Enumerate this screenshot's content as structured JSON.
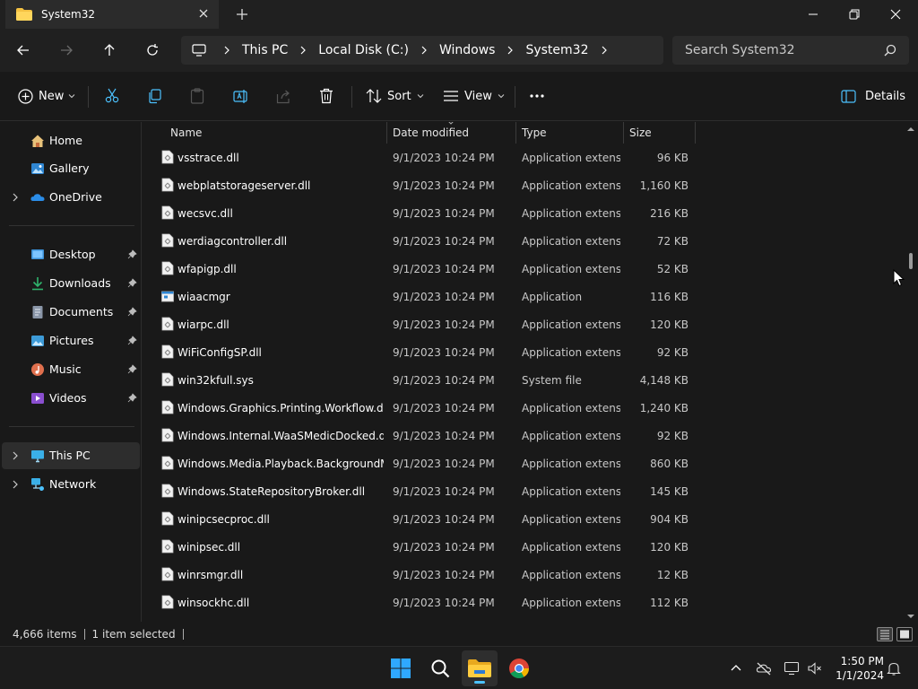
{
  "window": {
    "tab_title": "System32"
  },
  "address": {
    "crumbs": [
      "This PC",
      "Local Disk (C:)",
      "Windows",
      "System32"
    ],
    "search_placeholder": "Search System32"
  },
  "commands": {
    "new_label": "New",
    "sort_label": "Sort",
    "view_label": "View",
    "details_label": "Details"
  },
  "nav": {
    "top": [
      {
        "label": "Home",
        "icon": "home-icon",
        "expandable": false
      },
      {
        "label": "Gallery",
        "icon": "gallery-icon",
        "expandable": false
      },
      {
        "label": "OneDrive",
        "icon": "onedrive-icon",
        "expandable": true
      }
    ],
    "quick": [
      {
        "label": "Desktop",
        "icon": "desktop-icon",
        "color": "#3a8fd6"
      },
      {
        "label": "Downloads",
        "icon": "downloads-icon",
        "color": "#2fb36c"
      },
      {
        "label": "Documents",
        "icon": "documents-icon",
        "color": "#8a96a8"
      },
      {
        "label": "Pictures",
        "icon": "pictures-icon",
        "color": "#3d9bd8"
      },
      {
        "label": "Music",
        "icon": "music-icon",
        "color": "#e0704e"
      },
      {
        "label": "Videos",
        "icon": "videos-icon",
        "color": "#8a4fd0"
      }
    ],
    "devices": [
      {
        "label": "This PC",
        "icon": "this-pc-icon",
        "selected": true
      },
      {
        "label": "Network",
        "icon": "network-icon",
        "selected": false
      }
    ]
  },
  "columns": {
    "name": "Name",
    "date": "Date modified",
    "type": "Type",
    "size": "Size"
  },
  "files": [
    {
      "name": "vsstrace.dll",
      "date": "9/1/2023 10:24 PM",
      "type": "Application extens...",
      "size": "96 KB",
      "icon": "dll-file-icon"
    },
    {
      "name": "webplatstorageserver.dll",
      "date": "9/1/2023 10:24 PM",
      "type": "Application extens...",
      "size": "1,160 KB",
      "icon": "dll-file-icon"
    },
    {
      "name": "wecsvc.dll",
      "date": "9/1/2023 10:24 PM",
      "type": "Application extens...",
      "size": "216 KB",
      "icon": "dll-file-icon"
    },
    {
      "name": "werdiagcontroller.dll",
      "date": "9/1/2023 10:24 PM",
      "type": "Application extens...",
      "size": "72 KB",
      "icon": "dll-file-icon"
    },
    {
      "name": "wfapigp.dll",
      "date": "9/1/2023 10:24 PM",
      "type": "Application extens...",
      "size": "52 KB",
      "icon": "dll-file-icon"
    },
    {
      "name": "wiaacmgr",
      "date": "9/1/2023 10:24 PM",
      "type": "Application",
      "size": "116 KB",
      "icon": "exe-file-icon"
    },
    {
      "name": "wiarpc.dll",
      "date": "9/1/2023 10:24 PM",
      "type": "Application extens...",
      "size": "120 KB",
      "icon": "dll-file-icon"
    },
    {
      "name": "WiFiConfigSP.dll",
      "date": "9/1/2023 10:24 PM",
      "type": "Application extens...",
      "size": "92 KB",
      "icon": "dll-file-icon"
    },
    {
      "name": "win32kfull.sys",
      "date": "9/1/2023 10:24 PM",
      "type": "System file",
      "size": "4,148 KB",
      "icon": "sys-file-icon"
    },
    {
      "name": "Windows.Graphics.Printing.Workflow.dll",
      "date": "9/1/2023 10:24 PM",
      "type": "Application extens...",
      "size": "1,240 KB",
      "icon": "dll-file-icon"
    },
    {
      "name": "Windows.Internal.WaaSMedicDocked.dll",
      "date": "9/1/2023 10:24 PM",
      "type": "Application extens...",
      "size": "92 KB",
      "icon": "dll-file-icon"
    },
    {
      "name": "Windows.Media.Playback.BackgroundM...",
      "date": "9/1/2023 10:24 PM",
      "type": "Application extens...",
      "size": "860 KB",
      "icon": "dll-file-icon"
    },
    {
      "name": "Windows.StateRepositoryBroker.dll",
      "date": "9/1/2023 10:24 PM",
      "type": "Application extens...",
      "size": "145 KB",
      "icon": "dll-file-icon"
    },
    {
      "name": "winipcsecproc.dll",
      "date": "9/1/2023 10:24 PM",
      "type": "Application extens...",
      "size": "904 KB",
      "icon": "dll-file-icon"
    },
    {
      "name": "winipsec.dll",
      "date": "9/1/2023 10:24 PM",
      "type": "Application extens...",
      "size": "120 KB",
      "icon": "dll-file-icon"
    },
    {
      "name": "winrsmgr.dll",
      "date": "9/1/2023 10:24 PM",
      "type": "Application extens...",
      "size": "12 KB",
      "icon": "dll-file-icon"
    },
    {
      "name": "winsockhc.dll",
      "date": "9/1/2023 10:24 PM",
      "type": "Application extens...",
      "size": "112 KB",
      "icon": "dll-file-icon"
    }
  ],
  "status": {
    "item_count": "4,666 items",
    "selection": "1 item selected"
  },
  "clock": {
    "time": "1:50 PM",
    "date": "1/1/2024"
  }
}
